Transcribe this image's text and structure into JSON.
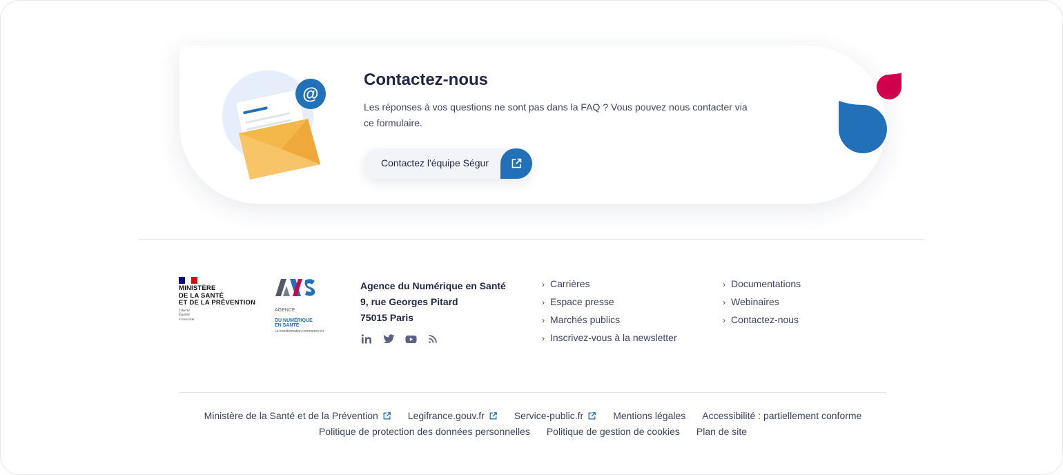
{
  "contact_card": {
    "title": "Contactez-nous",
    "text": "Les réponses à vos questions ne sont pas dans la FAQ ? Vous pouvez nous contacter via ce formulaire.",
    "cta_label": "Contactez l'équipe Ségur",
    "cta_icon": "external-link-icon",
    "illustration_icon": "envelope-email-icon"
  },
  "footer": {
    "ministry_logo": {
      "name": "MINISTÈRE\nDE LA SANTÉ\nET DE LA PRÉVENTION",
      "motto": "Liberté\nÉgalité\nFraternité"
    },
    "ans_logo": {
      "line1": "AGENCE",
      "line2": "DU NUMÉRIQUE\nEN SANTÉ",
      "tagline": "La transformation commence ici"
    },
    "address": {
      "name": "Agence du Numérique en Santé",
      "street": "9, rue Georges Pitard",
      "city": "75015 Paris"
    },
    "socials": [
      "linkedin-icon",
      "twitter-icon",
      "youtube-icon",
      "rss-icon"
    ],
    "links_col_a": [
      "Carrières",
      "Espace presse",
      "Marchés publics",
      "Inscrivez-vous à la newsletter"
    ],
    "links_col_b": [
      "Documentations",
      "Webinaires",
      "Contactez-nous"
    ],
    "bottom_row1": [
      "Ministère de la Santé et de la Prévention",
      "Legifrance.gouv.fr",
      "Service-public.fr",
      "Mentions légales",
      "Accessibilité : partiellement conforme"
    ],
    "bottom_row2": [
      "Politique de protection des données personnelles",
      "Politique de gestion de cookies",
      "Plan de site"
    ]
  },
  "colors": {
    "brand_blue": "#2170b8",
    "brand_pink": "#d1004f",
    "text_dark": "#1f2747",
    "envelope_yellow": "#f4b84a"
  }
}
